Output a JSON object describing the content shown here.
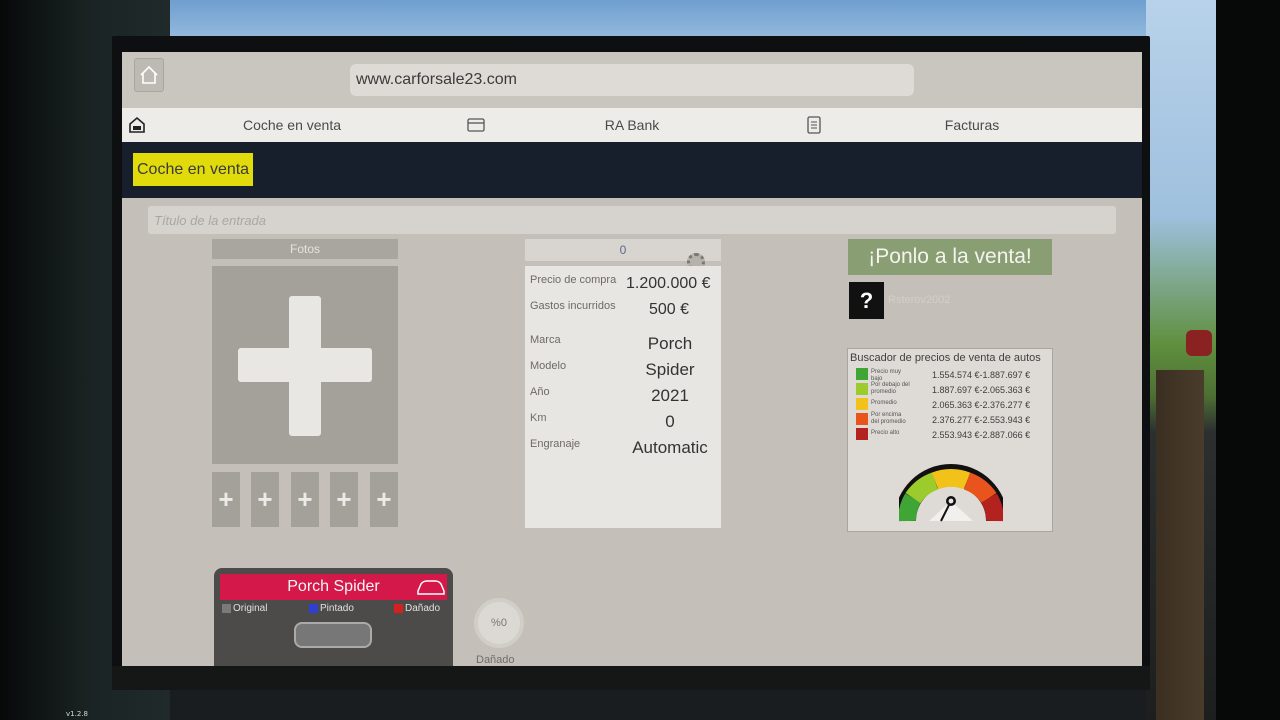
{
  "browser": {
    "url": "www.carforsale23.com",
    "home_icon": "home-icon"
  },
  "nav": {
    "items": [
      {
        "label": "Coche en venta",
        "icon": "car-house-icon"
      },
      {
        "label": "RA Bank",
        "icon": "card-icon"
      },
      {
        "label": "Facturas",
        "icon": "invoice-icon"
      }
    ]
  },
  "section": {
    "title": "Coche en venta"
  },
  "listing": {
    "title_placeholder": "Título de la entrada",
    "photos_label": "Fotos",
    "thumbnails": [
      "+",
      "+",
      "+",
      "+",
      "+"
    ],
    "price_input_value": "0",
    "details": {
      "purchase_price_label": "Precio de compra",
      "purchase_price_value": "1.200.000 €",
      "expenses_label": "Gastos incurridos",
      "expenses_value": "500 €",
      "brand_label": "Marca",
      "brand_value": "Porch",
      "model_label": "Modelo",
      "model_value": "Spider",
      "year_label": "Año",
      "year_value": "2021",
      "km_label": "Km",
      "km_value": "0",
      "gear_label": "Engranaje",
      "gear_value": "Automatic"
    },
    "sell_button": "¡Ponlo a la venta!",
    "help_button": "?",
    "username": "Rsterov2002"
  },
  "price_finder": {
    "title": "Buscador de precios de venta de autos",
    "rows": [
      {
        "label": "Precio muy bajo",
        "range": "1.554.574 €-1.887.697 €",
        "color": "#3fa535"
      },
      {
        "label": "Por debajo del promedio",
        "range": "1.887.697 €-2.065.363 €",
        "color": "#9ccc2c"
      },
      {
        "label": "Promedio",
        "range": "2.065.363 €-2.376.277 €",
        "color": "#f2c21a"
      },
      {
        "label": "Por encima del promedio",
        "range": "2.376.277 €-2.553.943 €",
        "color": "#e8541c"
      },
      {
        "label": "Precio alto",
        "range": "2.553.943 €-2.887.066 €",
        "color": "#b3221e"
      }
    ]
  },
  "car_status": {
    "name": "Porch Spider",
    "legend": {
      "original": "Original",
      "painted": "Pintado",
      "damaged": "Dañado"
    },
    "damage_percent": "%0",
    "damage_label": "Dañado"
  },
  "version": "v1.2.8"
}
